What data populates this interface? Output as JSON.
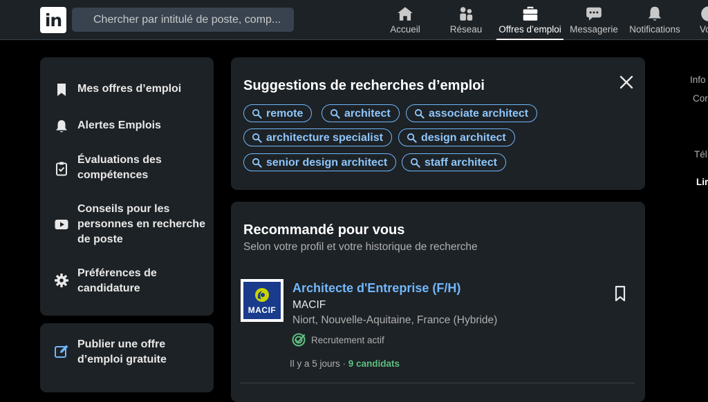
{
  "header": {
    "logo_text": "in",
    "search_placeholder": "Chercher par intitulé de poste, comp...",
    "nav": [
      {
        "label": "Accueil",
        "icon": "home-icon"
      },
      {
        "label": "Réseau",
        "icon": "network-icon"
      },
      {
        "label": "Offres d’emploi",
        "icon": "briefcase-icon",
        "active": true
      },
      {
        "label": "Messagerie",
        "icon": "chat-icon"
      },
      {
        "label": "Notifications",
        "icon": "bell-icon"
      },
      {
        "label": "Vo",
        "icon": "avatar-icon"
      }
    ]
  },
  "sidebar": {
    "items": [
      {
        "label": "Mes offres d’emploi",
        "icon": "bookmark-icon"
      },
      {
        "label": "Alertes Emplois",
        "icon": "bell-icon"
      },
      {
        "label": "Évaluations des compétences",
        "icon": "clipboard-check-icon"
      },
      {
        "label": "Conseils pour les personnes en recherche de poste",
        "icon": "video-play-icon"
      },
      {
        "label": "Préférences de candidature",
        "icon": "gear-icon"
      }
    ],
    "publish_label": "Publier une offre d’emploi gratuite"
  },
  "suggestions": {
    "title": "Suggestions de recherches d’emploi",
    "pills": [
      "remote",
      "architect",
      "associate architect",
      "architecture specialist",
      "design architect",
      "senior design architect",
      "staff architect"
    ]
  },
  "recommended": {
    "title": "Recommandé pour vous",
    "subtitle": "Selon votre profil et votre historique de recherche",
    "job": {
      "title": "Architecte d'Entreprise (F/H)",
      "company": "MACIF",
      "logo_word": "MACIF",
      "location": "Niort, Nouvelle-Aquitaine, France (Hybride)",
      "active_label": "Recrutement actif",
      "posted": "Il y a 5 jours · ",
      "candidates": "9 candidats"
    }
  },
  "right_panel": {
    "lines": [
      "Info",
      "Cor",
      "Tél",
      "Lir"
    ]
  },
  "colors": {
    "background": "#000000",
    "card": "#1d2226",
    "accent": "#71b7fb",
    "success": "#5fbf7f"
  }
}
